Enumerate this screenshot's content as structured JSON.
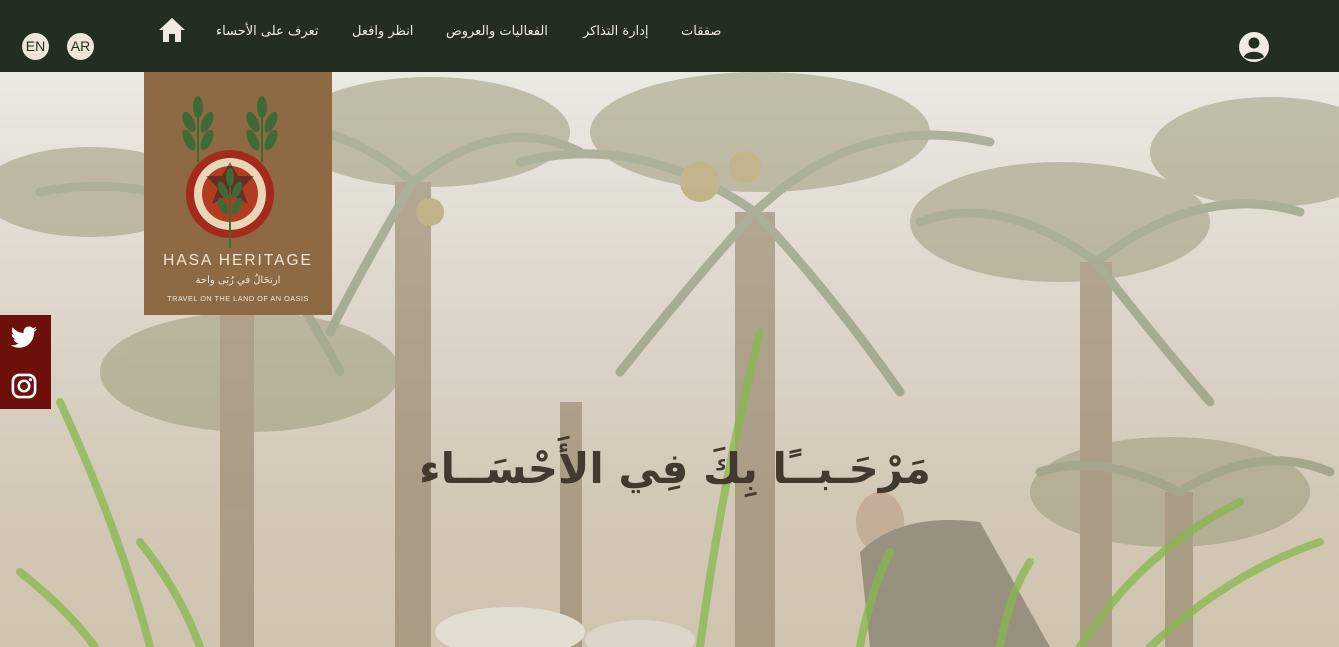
{
  "languages": {
    "en": "EN",
    "ar": "AR"
  },
  "nav": {
    "home_icon": "home-icon",
    "items": [
      {
        "label": "تعرف على الأحساء"
      },
      {
        "label": "انظر وافعل"
      },
      {
        "label": "الفعاليات والعروض"
      },
      {
        "label": "إدارة التذاكر"
      },
      {
        "label": "صفقات"
      }
    ],
    "user_icon": "user-account-icon"
  },
  "logo": {
    "title": "HASA HERITAGE",
    "arabic": "ارتحَالٌ في رُبَى واحة",
    "tagline": "TRAVEL ON THE LAND OF AN OASIS"
  },
  "social": [
    {
      "icon": "twitter-icon"
    },
    {
      "icon": "instagram-icon"
    }
  ],
  "hero": {
    "heading": "مَرْحَـبــًا بِكَ فِي الأَحْسَــاء"
  },
  "colors": {
    "topbar": "#232d20",
    "logo_bg": "#8d6a44",
    "social_bg": "#6d0f0b",
    "heading": "#433a2f"
  }
}
